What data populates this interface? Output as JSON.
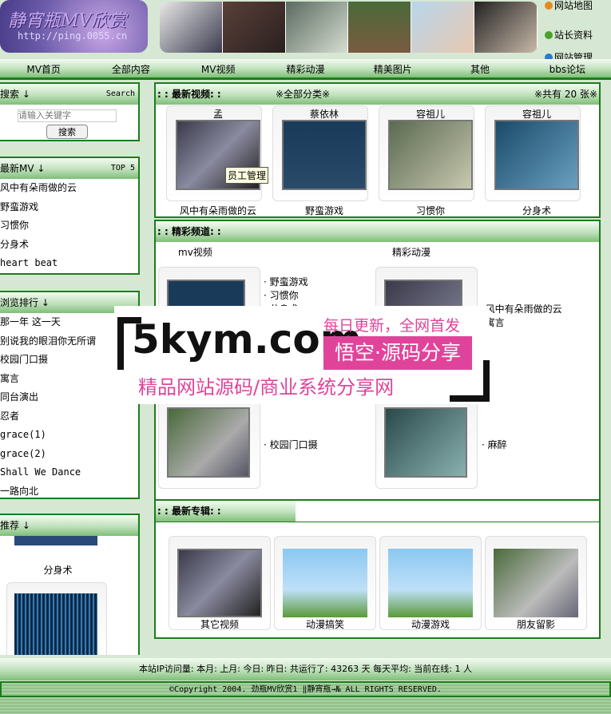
{
  "header": {
    "logo_title": "静宵瓶MV欣赏",
    "logo_url": "http://ping.0055.cn",
    "links": [
      "网站地图",
      "站长资料",
      "网站管理"
    ]
  },
  "nav": [
    "MV首页",
    "全部内容",
    "MV视频",
    "精彩动漫",
    "精美图片",
    "其他",
    "bbs论坛"
  ],
  "search": {
    "title": "搜索 ↓",
    "right": "Search",
    "placeholder": "请输入关键字",
    "button": "搜索"
  },
  "latest_mv": {
    "title": "最新MV ↓",
    "right": "TOP 5",
    "items": [
      "风中有朵雨做的云",
      "野蛮游戏",
      "习惯你",
      "分身术",
      "heart beat"
    ]
  },
  "ranking": {
    "title": "浏览排行 ↓",
    "items": [
      "那一年 这一天",
      "别说我的眼泪你无所谓",
      "校园门口摄",
      "寓言",
      "同台演出",
      "忍者",
      "grace(1)",
      "grace(2)",
      "Shall We Dance",
      "一路向北"
    ]
  },
  "recommend": {
    "title": "推荐 ↓",
    "items": [
      "分身术"
    ]
  },
  "latest_video": {
    "title": ": : 最新视频: :",
    "category": "※全部分类※",
    "count": "※共有 20 张※",
    "items": [
      {
        "top": "孟",
        "bottom": "风中有朵雨做的云"
      },
      {
        "top": "蔡依林",
        "bottom": "野蛮游戏"
      },
      {
        "top": "容祖儿",
        "bottom": "习惯你"
      },
      {
        "top": "容祖儿",
        "bottom": "分身术"
      }
    ],
    "tooltip": "员工管理"
  },
  "channels": {
    "title": ": : 精彩频道: :",
    "mv": {
      "label": "mv视频",
      "list": [
        "· 野蛮游戏",
        "· 习惯你",
        "· 分身术"
      ],
      "list2": [
        "· 校园门口摄"
      ]
    },
    "anime": {
      "label": "精彩动漫",
      "list": [
        "· 风中有朵雨做的云",
        "· 寓言"
      ],
      "list2": [
        "· 麻醉"
      ]
    }
  },
  "albums": {
    "title": ": : 最新专辑: :",
    "items": [
      "其它视频",
      "动漫搞笑",
      "动漫游戏",
      "朋友留影"
    ]
  },
  "footer": {
    "stats": "本站IP访问量:  本月:  上月:  今日:  昨日:  共运行了: 43263 天  每天平均:  当前在线: 1 人",
    "copyright": "©Copyright 2004. 劲瓶MV欣赏1 ‖静宵瓶→№ ALL RIGHTS RESERVED."
  },
  "watermark": {
    "brand": "5kym.com",
    "slogan": "每日更新，全网首发",
    "tag": "悟空·源码分享",
    "sub": "精品网站源码/商业系统分享网"
  }
}
